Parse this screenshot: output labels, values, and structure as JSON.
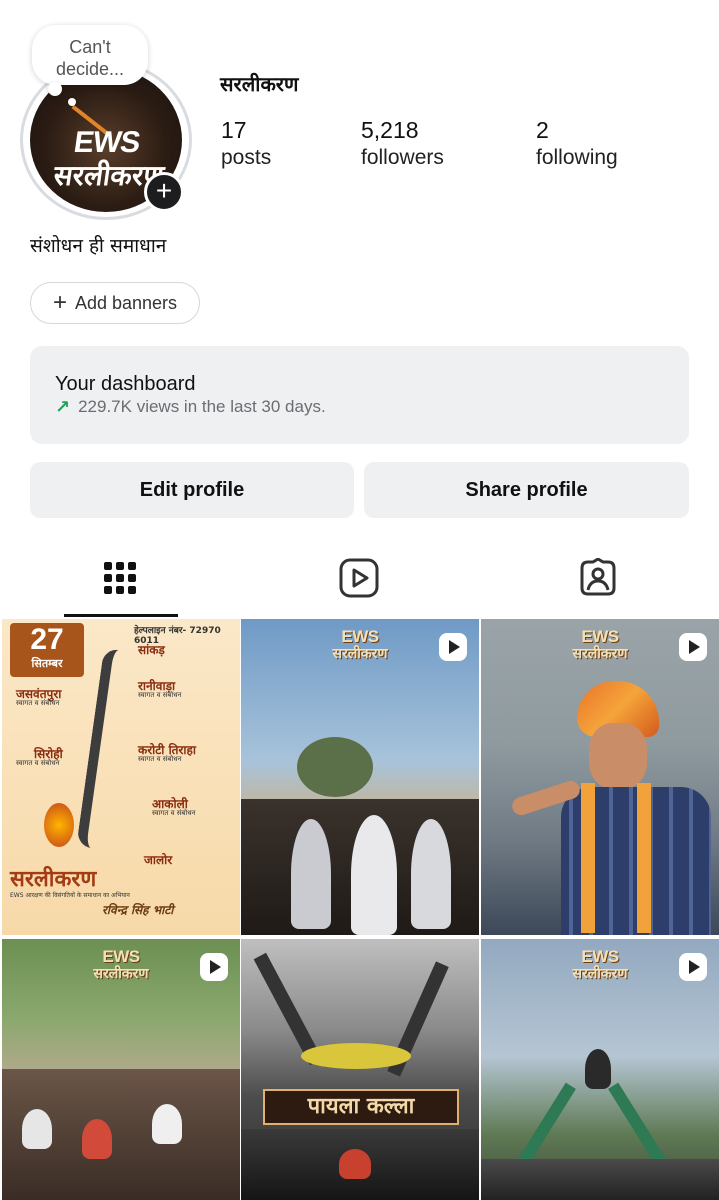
{
  "note": {
    "line1": "Can't",
    "line2": "decide..."
  },
  "avatar": {
    "brand_line1": "EWS",
    "brand_line2": "सरलीकरण"
  },
  "profile": {
    "username": "सरलीकरण",
    "bio": "संशोधन ही समाधान",
    "stats": {
      "posts": {
        "value": "17",
        "label": "posts"
      },
      "followers": {
        "value": "5,218",
        "label": "followers"
      },
      "following": {
        "value": "2",
        "label": "following"
      }
    }
  },
  "banners": {
    "label": "Add banners"
  },
  "dashboard": {
    "title": "Your dashboard",
    "subtitle": "229.7K views in the last 30 days."
  },
  "actions": {
    "edit": "Edit profile",
    "share": "Share profile"
  },
  "tabs": [
    {
      "name": "grid",
      "icon": "grid-icon",
      "active": true
    },
    {
      "name": "reels",
      "icon": "reels-icon",
      "active": false
    },
    {
      "name": "tagged",
      "icon": "tagged-icon",
      "active": false
    }
  ],
  "grid": {
    "brand_line1": "EWS",
    "brand_line2": "सरलीकरण",
    "poster": {
      "date_day": "27",
      "date_month": "सितम्बर",
      "helpline": "हेल्पलाइन नंबर- 72970 6011",
      "stops": [
        "सांकड़",
        "रानीवाड़ा",
        "जसवंतपुरा",
        "करोटी तिराहा",
        "सिरोही",
        "आकोली",
        "जालोर"
      ],
      "stop_detail": "स्वागत व संबोधन",
      "title": "सरलीकरण",
      "footer": "EWS आरक्षण की विसंगतियों के समाधान का अभियान",
      "signature": "रविन्द्र सिंह भाटी"
    },
    "tile5_banner": "पायला कल्ला"
  },
  "colors": {
    "accent_green": "#1aa65a",
    "button_bg": "#eff0f2",
    "text": "#111111"
  }
}
